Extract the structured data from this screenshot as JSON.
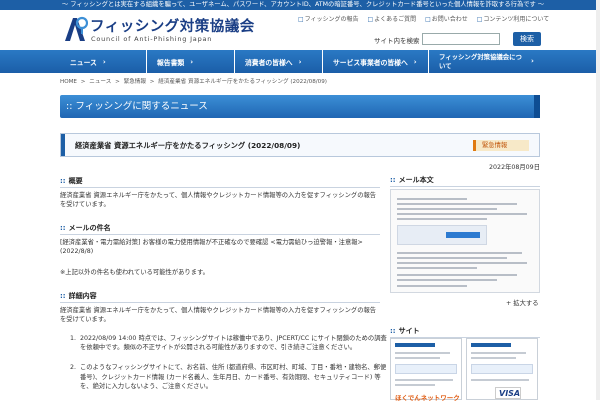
{
  "tagline": "～ フィッシングとは実在する組織を騙って、ユーザネーム、パスワード、アカウントID、ATMの暗証番号、クレジットカード番号といった個人情報を詐取する行為です ～",
  "logo": {
    "name_jp": "フィッシング対策協議会",
    "name_en": "Council of Anti-Phishing Japan"
  },
  "utility_links": [
    "フィッシングの報告",
    "よくあるご質問",
    "お問い合わせ",
    "コンテンツ利用について"
  ],
  "search": {
    "label": "サイト内を検索",
    "button": "検索",
    "placeholder": ""
  },
  "nav": [
    {
      "label": "ニュース"
    },
    {
      "label": "報告書類"
    },
    {
      "label": "消費者の皆様へ"
    },
    {
      "label": "サービス事業者の皆様へ"
    },
    {
      "label": "フィッシング対策協議会について"
    }
  ],
  "breadcrumb": [
    "HOME",
    ">",
    "ニュース",
    ">",
    "緊急情報",
    ">",
    "経済産業省 資源エネルギー庁をかたるフィッシング (2022/08/09)"
  ],
  "banner_title": ":: フィッシングに関するニュース",
  "article": {
    "title": "経済産業省 資源エネルギー庁をかたるフィッシング (2022/08/09)",
    "badge": "緊急情報",
    "date": "2022年08月09日",
    "summary_heading": "概要",
    "summary_text": "経済産業省 資源エネルギー庁をかたって、個人情報やクレジットカード情報等の入力を促すフィッシングの報告を受けています。",
    "subject_heading": "メールの件名",
    "subject_text": "[経済産業省・電力需給対策] お客様の電力使用情報が不正確なので要確認 <電力需給ひっ迫警報・注意報> (2022/8/8)",
    "subject_note": "※上記以外の件名も使われている可能性があります。",
    "detail_heading": "詳細内容",
    "detail_text": "経済産業省 資源エネルギー庁をかたって、個人情報やクレジットカード情報等の入力を促すフィッシングの報告を受けています。",
    "detail_items": [
      {
        "n": "1.",
        "text": "2022/08/09 14:00 時点では、フィッシングサイトは稼働中であり、JPCERT/CC にサイト閉鎖のための調査を依頼中です。類似の不正サイトが公開される可能性がありますので、引き続きご注意ください。"
      },
      {
        "n": "2.",
        "text": "このようなフィッシングサイトにて、お名前、住所 (都道府県、市区町村、町域、丁目・番地・建物名、郵便番号)、クレジットカード情報 (カード名義人、生年月日、カード番号、有効期限、セキュリティコード) 等を、絶対に入力しないよう、ご注意ください。"
      }
    ]
  },
  "sidebar": {
    "mail_heading": "メール本文",
    "zoom_label": "拡大する",
    "site_heading": "サイト",
    "card_logo": "ほくでんネットワーク",
    "visa": "VISA"
  },
  "colors": {
    "primary": "#1d5fa6",
    "alert": "#e07a10"
  }
}
